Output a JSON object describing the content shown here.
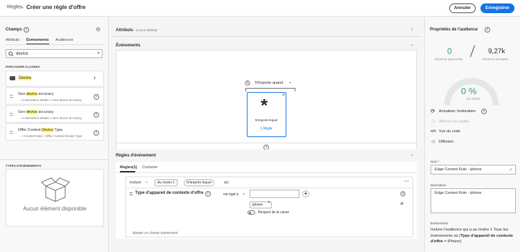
{
  "topbar": {
    "breadcrumb": "Règles",
    "separator": "›",
    "title": "Créer une règle d'offre",
    "cancel_label": "Annuler",
    "save_label": "Enregistrer"
  },
  "left": {
    "header": "Champs",
    "tabs": [
      "Attributs",
      "Événements",
      "Audiences"
    ],
    "search_value": "device",
    "section_title": "PARCOURIR CLASSES",
    "folder": {
      "label": "Device"
    },
    "items": [
      {
        "pre": "Geo ",
        "hl": "device",
        "post": " accuracy",
        "path": "...e interaction details > Geo device accuracy"
      },
      {
        "pre": "Geo ",
        "hl": "device",
        "post": " accuracy",
        "path": "...e interaction details > Geo device accuracy"
      },
      {
        "pre": "Offer Context ",
        "hl": "Device",
        "post": " Type",
        "path": "...r Context Data > Offer Context Device Type"
      }
    ],
    "event_types_title": "TYPES D'ÉVÉNEMENTS",
    "empty_label": "Aucun élément disponible"
  },
  "center": {
    "attributes_title": "Attributs",
    "attributes_sub": " - (Aucun attribut)",
    "events_title": "Événements",
    "when_label": "N'importe quand",
    "card_label": "N'importe lequel",
    "card_link": "1 Règle",
    "rules_title": "Règles d'événement",
    "rules_tabs": [
      "Règles(1)",
      "Contexte"
    ],
    "include_label": "Inclure",
    "atleast_label": "Au moins 1",
    "any_tag": "N'importe lequel",
    "of_label": "où:",
    "condition_field": "Type d'appareil de contexte d'offre",
    "operator": "est égal à",
    "value_tag": "iphone",
    "case_label": "Respect de la casse",
    "add_field_placeholder": "Ajouter un champ événement"
  },
  "right": {
    "header": "Propriétés de l'audience",
    "qualified_value": "0",
    "qualified_caption": "PROFILS QUALIFIÉS",
    "estimated_value": "9,27k",
    "estimated_caption": "PROFILS ESTIMÉS",
    "percent": "0 %",
    "percent_caption": "DU TOTAL",
    "actions": [
      "Actualiser l'estimation",
      "Afficher les profils",
      "Vue du code",
      "Diffusion"
    ],
    "name_label": "Nom",
    "name_value": "Edge Context Rule - iphone",
    "desc_label": "Description",
    "desc_value": "Edge Context Rule - iphone",
    "events_label": "Événements",
    "events_text1": "Inclure l'audience qui a au moins 1 Tous les événements où (",
    "events_text_bold": "Type d'appareil de contexte d'offre",
    "events_text2": " = iPhone)",
    "accent": "#1473e6",
    "green": "#2d9d78"
  }
}
